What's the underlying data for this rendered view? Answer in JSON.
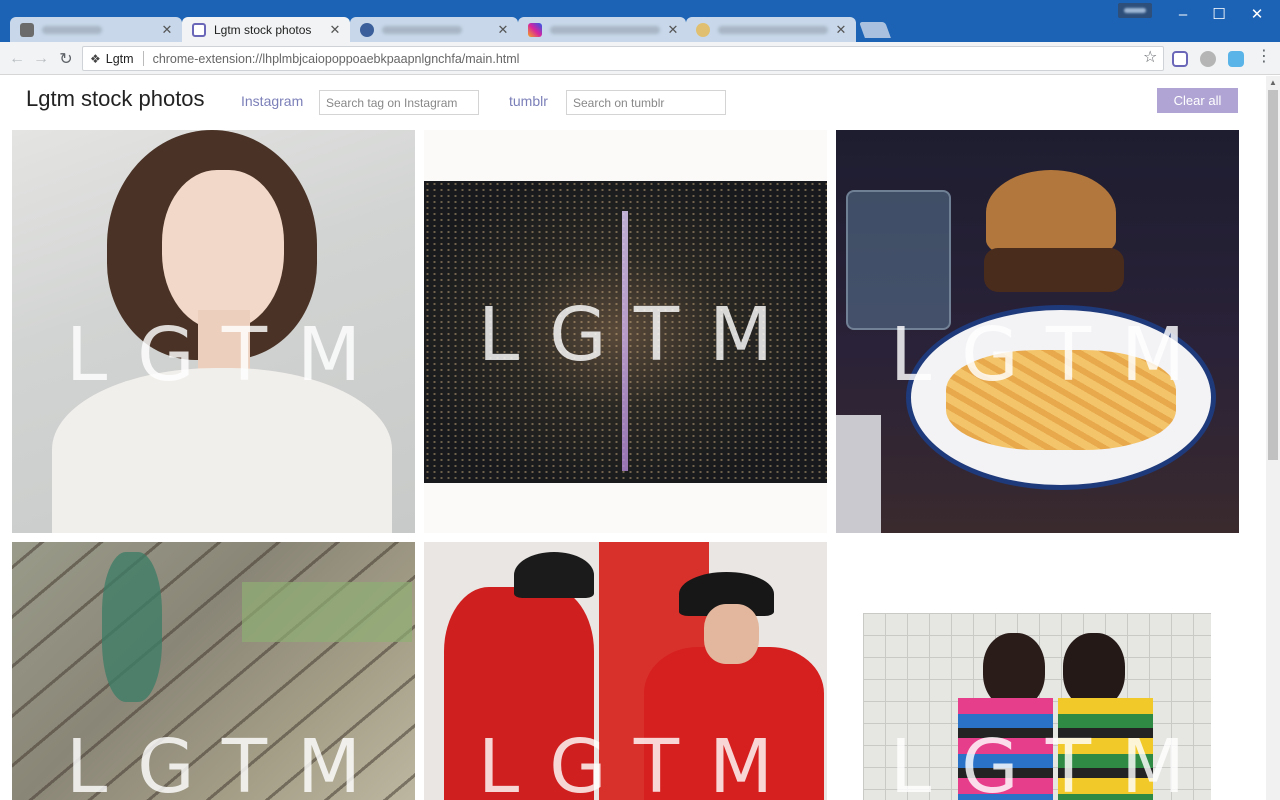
{
  "browser": {
    "tabs": [
      {
        "title": "",
        "favicon": "extension-icon",
        "active": false
      },
      {
        "title": "Lgtm stock photos",
        "favicon": "lgtm-app-icon",
        "active": true
      },
      {
        "title": "",
        "favicon": "blurred-site-icon",
        "active": false
      },
      {
        "title": "",
        "favicon": "instagram-icon",
        "active": false
      },
      {
        "title": "",
        "favicon": "blurred-site-icon",
        "active": false
      }
    ],
    "close_glyph": "✕",
    "omnibox": {
      "site_label": "Lgtm",
      "url": "chrome-extension://lhplmbjcaiopoppoaebkpaapnlgnchfa/main.html"
    }
  },
  "app": {
    "title": "Lgtm stock photos",
    "instagram_label": "Instagram",
    "instagram_placeholder": "Search tag on Instagram",
    "tumblr_label": "tumblr",
    "tumblr_placeholder": "Search on tumblr",
    "clear_label": "Clear all"
  },
  "photos": [
    {
      "id": "portrait",
      "overlay": "LGTM"
    },
    {
      "id": "night-city",
      "overlay": "LGTM"
    },
    {
      "id": "burger",
      "overlay": "LGTM"
    },
    {
      "id": "railway",
      "overlay": "LGTM"
    },
    {
      "id": "racing",
      "overlay": "LGTM"
    },
    {
      "id": "two-girls",
      "overlay": "LGTM"
    }
  ],
  "colors": {
    "titlebar": "#1c63b5",
    "link": "#7b7fb8",
    "clear_button": "#b0a4d4"
  }
}
